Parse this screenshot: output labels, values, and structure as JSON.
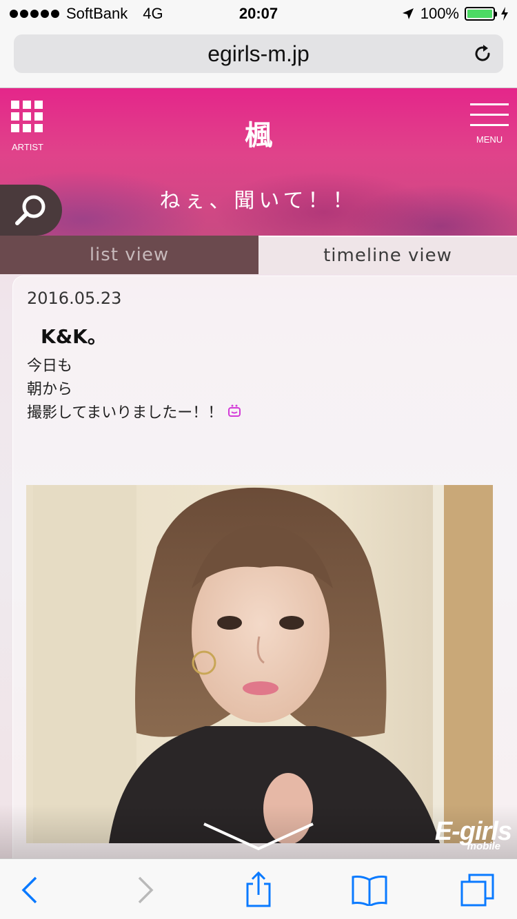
{
  "status_bar": {
    "carrier": "SoftBank",
    "network": "4G",
    "time": "20:07",
    "battery": "100%"
  },
  "browser": {
    "url": "egirls-m.jp",
    "reload_icon": "reload-icon"
  },
  "header": {
    "artist_label": "ARTIST",
    "menu_label": "MENU",
    "title": "楓",
    "subtitle": "ねぇ、聞いて！！",
    "accent_color": "#e4268a"
  },
  "tabs": [
    {
      "label": "list view",
      "active": false
    },
    {
      "label": "timeline view",
      "active": true
    }
  ],
  "post": {
    "date": "2016.05.23",
    "title": "K&K。",
    "body_lines": [
      "今日も",
      "朝から",
      "撮影してまいりましたー！！"
    ],
    "emoji": "smile-face-icon"
  },
  "logo": {
    "main": "E-girls",
    "sub": "mobile"
  },
  "toolbar": {
    "back_icon": "back-icon",
    "forward_icon": "forward-icon",
    "share_icon": "share-icon",
    "bookmarks_icon": "bookmarks-icon",
    "tabs_icon": "tabs-icon"
  }
}
